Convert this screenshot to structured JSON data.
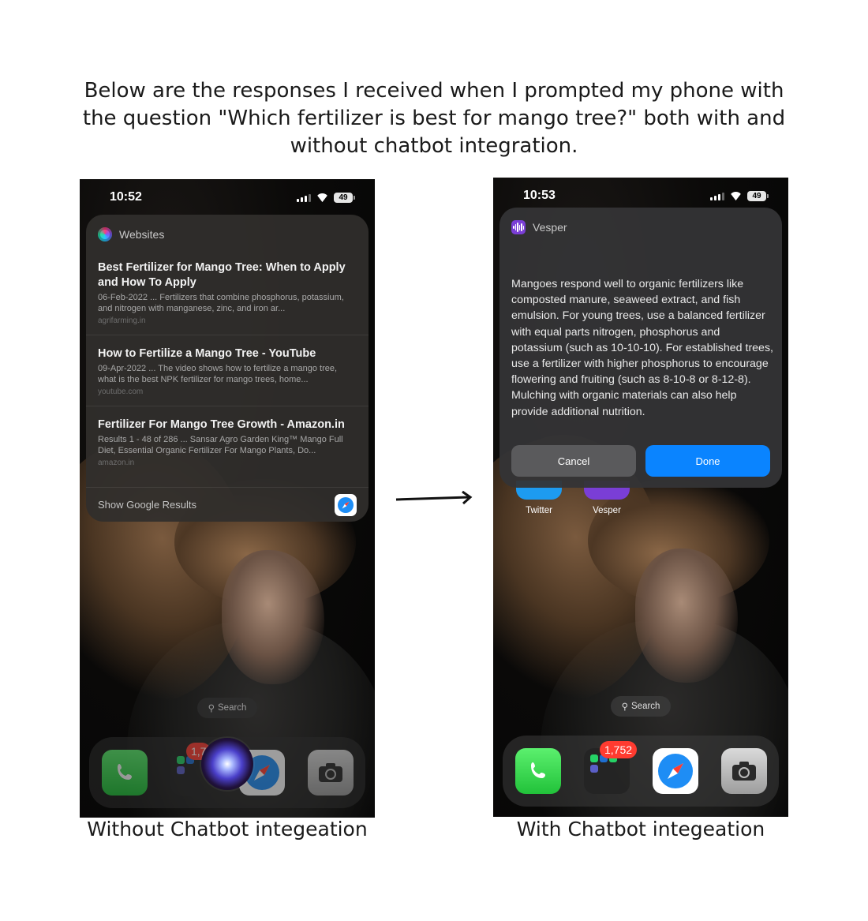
{
  "intro": "Below are the responses I received when I prompted my phone with the question \"Which fertilizer is best for mango tree?\" both with and without chatbot integration.",
  "left_phone": {
    "time": "10:52",
    "battery": "49",
    "card_label": "Websites",
    "results": [
      {
        "title": "Best Fertilizer for Mango Tree: When to Apply and How To Apply",
        "snippet": "06-Feb-2022 ... Fertilizers that combine phosphorus, potassium, and nitrogen with manganese, zinc, and iron ar...",
        "domain": "agrifarming.in"
      },
      {
        "title": "How to Fertilize a Mango Tree - YouTube",
        "snippet": "09-Apr-2022 ... The video shows how to fertilize a mango tree, what is the best NPK fertilizer for mango trees, home...",
        "domain": "youtube.com"
      },
      {
        "title": "Fertilizer For Mango Tree Growth - Amazon.in",
        "snippet": "Results 1 - 48 of 286 ... Sansar Agro Garden King™ Mango Full Diet, Essential Organic Fertilizer For Mango Plants, Do...",
        "domain": "amazon.in"
      }
    ],
    "show_google": "Show Google Results",
    "search_label": "Search",
    "badge": "1,7"
  },
  "right_phone": {
    "time": "10:53",
    "battery": "49",
    "card_label": "Vesper",
    "response": "Mangoes respond well to organic fertilizers like composted manure, seaweed extract, and fish emulsion. For young trees, use a balanced fertilizer with equal parts nitrogen, phosphorus and potassium (such as 10-10-10). For established trees, use a fertilizer with higher phosphorus to encourage flowering and fruiting (such as 8-10-8 or 8-12-8). Mulching with organic materials can also help provide additional nutrition.",
    "cancel_label": "Cancel",
    "done_label": "Done",
    "home_apps": [
      "Twitter",
      "Vesper"
    ],
    "search_label": "Search",
    "badge": "1,752"
  },
  "captions": {
    "left": "Without Chatbot integeation",
    "right": "With Chatbot integeation"
  },
  "colors": {
    "accent_blue": "#0a84ff",
    "badge_red": "#ff3b30",
    "vesper_purple": "#7a3ed6"
  }
}
